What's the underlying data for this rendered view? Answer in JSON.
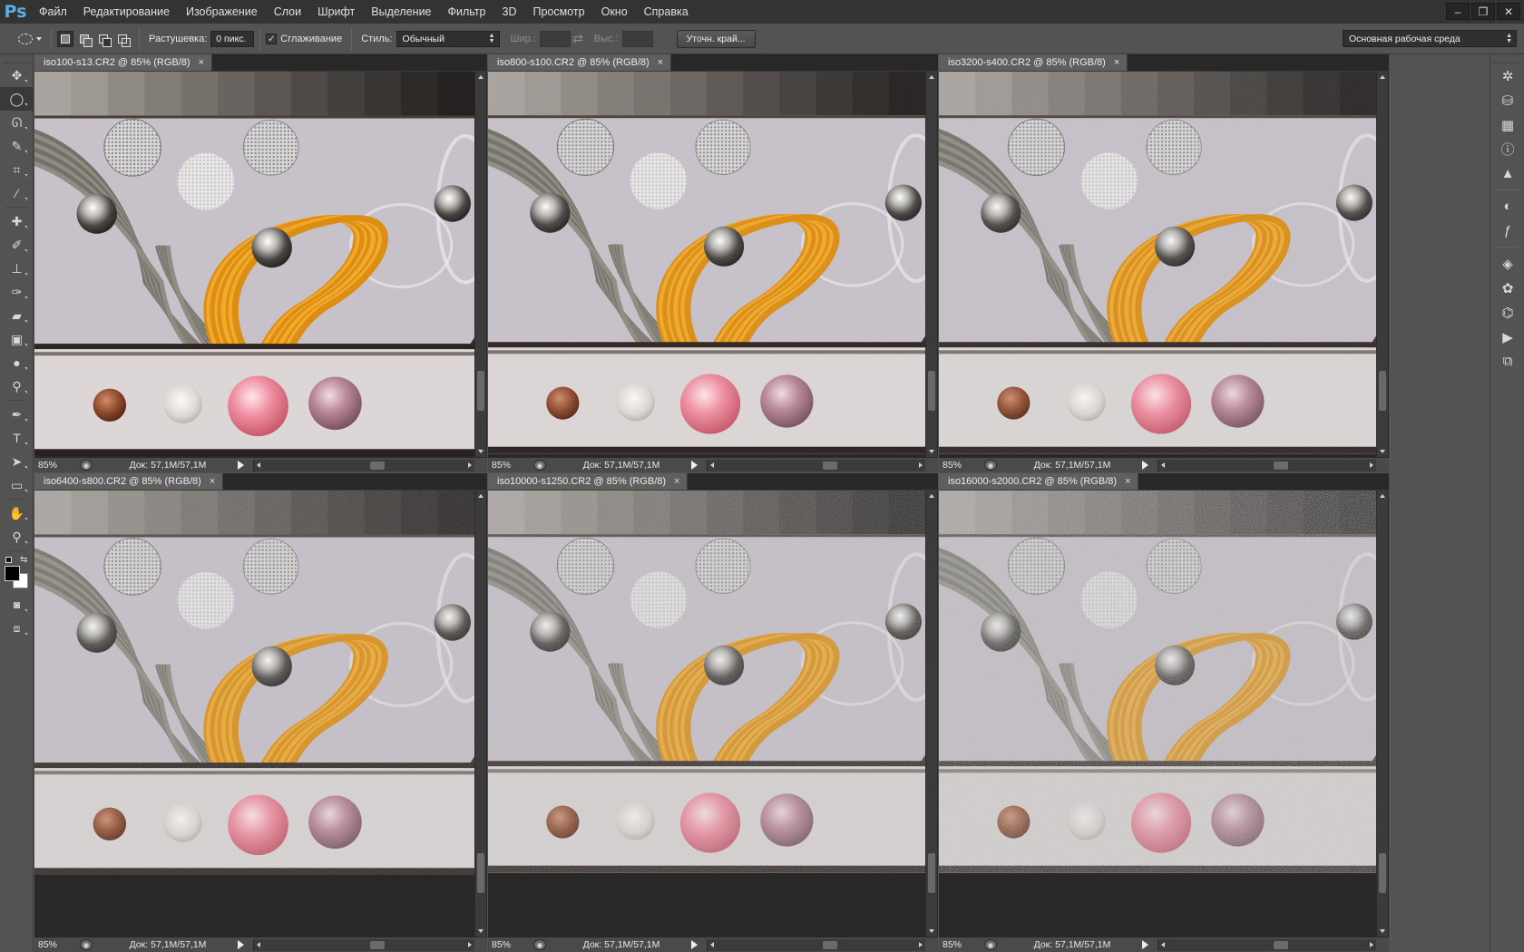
{
  "app": {
    "logo": "Ps"
  },
  "menu": [
    "Файл",
    "Редактирование",
    "Изображение",
    "Слои",
    "Шрифт",
    "Выделение",
    "Фильтр",
    "3D",
    "Просмотр",
    "Окно",
    "Справка"
  ],
  "window_controls": [
    "–",
    "❐",
    "✕"
  ],
  "options": {
    "feather_label": "Растушевка:",
    "feather_value": "0 пикс.",
    "antialias_label": "Сглаживание",
    "antialias_checked": true,
    "style_label": "Стиль:",
    "style_value": "Обычный",
    "width_label": "Шир.:",
    "height_label": "Выс.:",
    "refine_button": "Уточн. край...",
    "workspace_value": "Основная рабочая среда"
  },
  "tools": [
    {
      "icon": "move-icon",
      "glyph": "✥"
    },
    {
      "icon": "elliptical-marquee-icon",
      "glyph": "◯",
      "active": true
    },
    {
      "icon": "lasso-icon",
      "glyph": "ᘏ"
    },
    {
      "icon": "quick-selection-icon",
      "glyph": "✎"
    },
    {
      "icon": "crop-icon",
      "glyph": "⌗"
    },
    {
      "icon": "eyedropper-icon",
      "glyph": "⁄"
    },
    {
      "icon": "spot-healing-icon",
      "glyph": "✚"
    },
    {
      "icon": "brush-icon",
      "glyph": "✐"
    },
    {
      "icon": "clone-stamp-icon",
      "glyph": "⊥"
    },
    {
      "icon": "history-brush-icon",
      "glyph": "✑"
    },
    {
      "icon": "eraser-icon",
      "glyph": "▰"
    },
    {
      "icon": "gradient-icon",
      "glyph": "▣"
    },
    {
      "icon": "blur-icon",
      "glyph": "●"
    },
    {
      "icon": "dodge-icon",
      "glyph": "⚲"
    },
    {
      "icon": "pen-icon",
      "glyph": "✒"
    },
    {
      "icon": "type-icon",
      "glyph": "T"
    },
    {
      "icon": "path-selection-icon",
      "glyph": "➤"
    },
    {
      "icon": "rectangle-shape-icon",
      "glyph": "▭"
    },
    {
      "icon": "hand-icon",
      "glyph": "✋"
    },
    {
      "icon": "zoom-icon",
      "glyph": "⚲"
    }
  ],
  "colors": {
    "foreground": "#000000",
    "background": "#ffffff",
    "ui_dark": "#282828",
    "ui_panel": "#535353"
  },
  "documents": [
    {
      "title": "iso100-s13.CR2 @ 85% (RGB/8)",
      "zoom": "85%",
      "doc_info": "Док: 57,1M/57,1M",
      "noise": 0.0
    },
    {
      "title": "iso800-s100.CR2 @ 85% (RGB/8)",
      "zoom": "85%",
      "doc_info": "Док: 57,1M/57,1M",
      "noise": 0.05
    },
    {
      "title": "iso3200-s400.CR2 @ 85% (RGB/8)",
      "zoom": "85%",
      "doc_info": "Док: 57,1M/57,1M",
      "noise": 0.12
    },
    {
      "title": "iso6400-s800.CR2 @ 85% (RGB/8)",
      "zoom": "85%",
      "doc_info": "Док: 57,1M/57,1M",
      "noise": 0.22
    },
    {
      "title": "iso10000-s1250.CR2 @ 85% (RGB/8)",
      "zoom": "85%",
      "doc_info": "Док: 57,1M/57,1M",
      "noise": 0.32
    },
    {
      "title": "iso16000-s2000.CR2 @ 85% (RGB/8)",
      "zoom": "85%",
      "doc_info": "Док: 57,1M/57,1M",
      "noise": 0.45
    }
  ],
  "tab_close": "×",
  "right_panels": [
    {
      "icon": "navigator-icon",
      "glyph": "✲"
    },
    {
      "icon": "3d-panel-icon",
      "glyph": "⛁"
    },
    {
      "icon": "swatches-panel-icon",
      "glyph": "▦"
    },
    {
      "icon": "info-panel-icon",
      "glyph": "ⓘ"
    },
    {
      "icon": "histogram-panel-icon",
      "glyph": "▲"
    },
    {
      "icon": "adjustments-panel-icon",
      "glyph": "◐"
    },
    {
      "icon": "styles-panel-icon",
      "glyph": "ƒ"
    },
    {
      "icon": "layers-panel-icon",
      "glyph": "◈"
    },
    {
      "icon": "channels-panel-icon",
      "glyph": "✿"
    },
    {
      "icon": "paths-panel-icon",
      "glyph": "⌬"
    },
    {
      "icon": "actions-panel-icon",
      "glyph": "▶"
    },
    {
      "icon": "history-panel-icon",
      "glyph": "⧉"
    }
  ]
}
